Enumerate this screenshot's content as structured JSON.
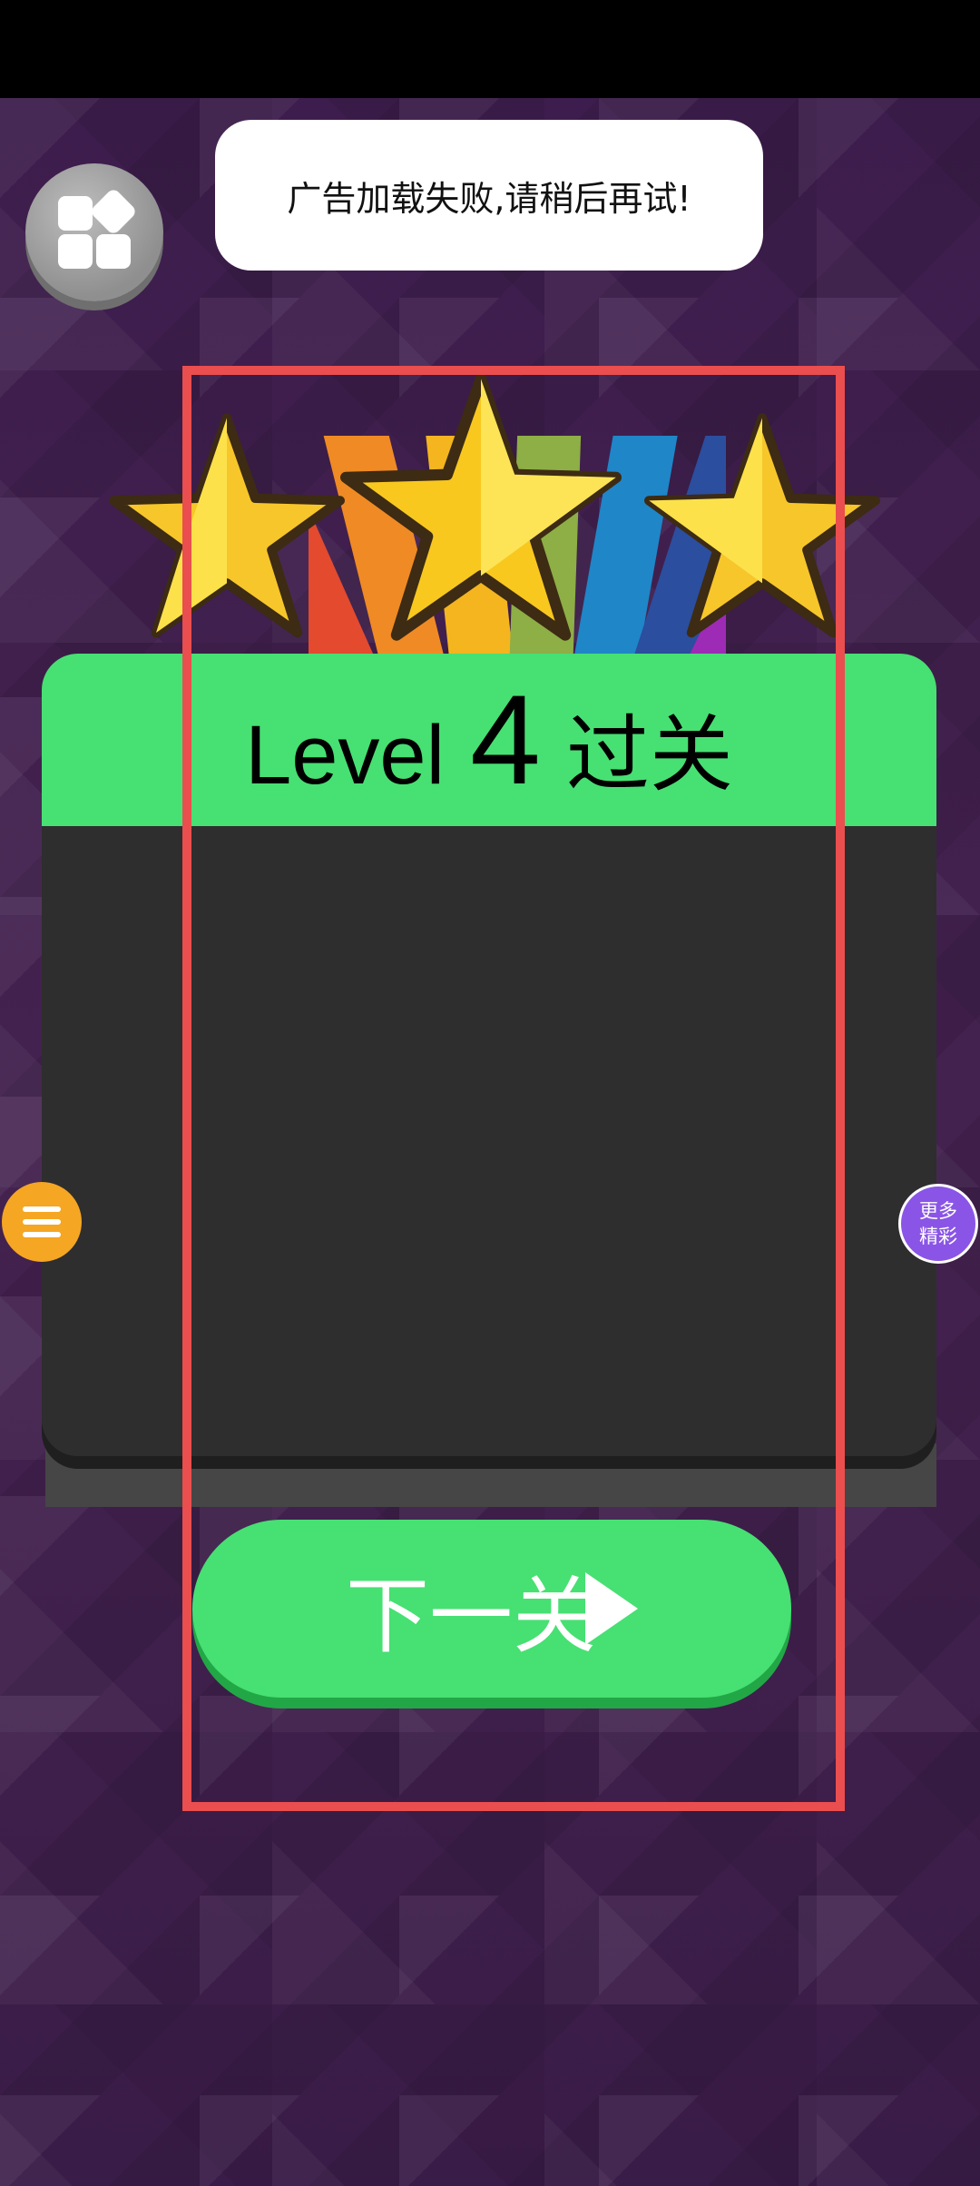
{
  "toast": {
    "message": "广告加载失败,请稍后再试!"
  },
  "level_panel": {
    "level_word": "Level",
    "level_number": "4",
    "status": "过关",
    "stars_earned": 3,
    "stars_total": 3
  },
  "next_button": {
    "label": "下一关"
  },
  "side_right": {
    "line1": "更多",
    "line2": "精彩"
  },
  "icons": {
    "menu": "grid-menu-icon",
    "side_left": "list-icon",
    "next": "play-arrow-icon"
  },
  "colors": {
    "accent_green": "#47e073",
    "card_dark": "#2e2e2e",
    "highlight_red": "#ea4e4e",
    "side_left_orange": "#f5a623",
    "side_right_purple": "#8a55e6"
  }
}
